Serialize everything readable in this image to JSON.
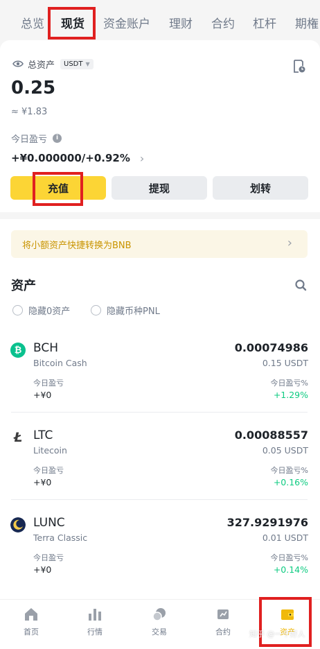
{
  "tabs": [
    "总览",
    "现货",
    "资金账户",
    "理财",
    "合约",
    "杠杆",
    "期権"
  ],
  "header": {
    "total_label": "总资产",
    "currency": "USDT",
    "balance": "0.25",
    "cny": "≈ ¥1.83",
    "pl_label": "今日盈亏",
    "pl_value": "+¥0.000000",
    "pl_separator": "/",
    "pl_pct": "+0.92%"
  },
  "actions": {
    "deposit": "充值",
    "withdraw": "提现",
    "transfer": "划转"
  },
  "banner": {
    "text": "将小额资产快捷转换为BNB"
  },
  "assets_section": {
    "title": "资产",
    "hide_zero": "隐藏0资产",
    "hide_pnl": "隐藏币种PNL"
  },
  "assets": [
    {
      "symbol": "BCH",
      "name": "Bitcoin Cash",
      "amount": "0.00074986",
      "usdt": "0.15 USDT",
      "pl_label": "今日盈亏",
      "pl": "+¥0",
      "pct_label": "今日盈亏%",
      "pct": "+1.29%",
      "color": "#0ac18e"
    },
    {
      "symbol": "LTC",
      "name": "Litecoin",
      "amount": "0.00088557",
      "usdt": "0.05 USDT",
      "pl_label": "今日盈亏",
      "pl": "+¥0",
      "pct_label": "今日盈亏%",
      "pct": "+0.16%",
      "color": "#3c3c3d"
    },
    {
      "symbol": "LUNC",
      "name": "Terra Classic",
      "amount": "327.9291976",
      "usdt": "0.01 USDT",
      "pl_label": "今日盈亏",
      "pl": "+¥0",
      "pct_label": "今日盈亏%",
      "pct": "+0.14%",
      "color": "#172852"
    }
  ],
  "bottom_nav": [
    "首页",
    "行情",
    "交易",
    "合约",
    "资产"
  ],
  "watermark": "知乎 @一个好人",
  "colors": {
    "accent": "#fcd535",
    "up": "#0ecb81",
    "highlight": "#e02020",
    "banner_text": "#c99400"
  }
}
